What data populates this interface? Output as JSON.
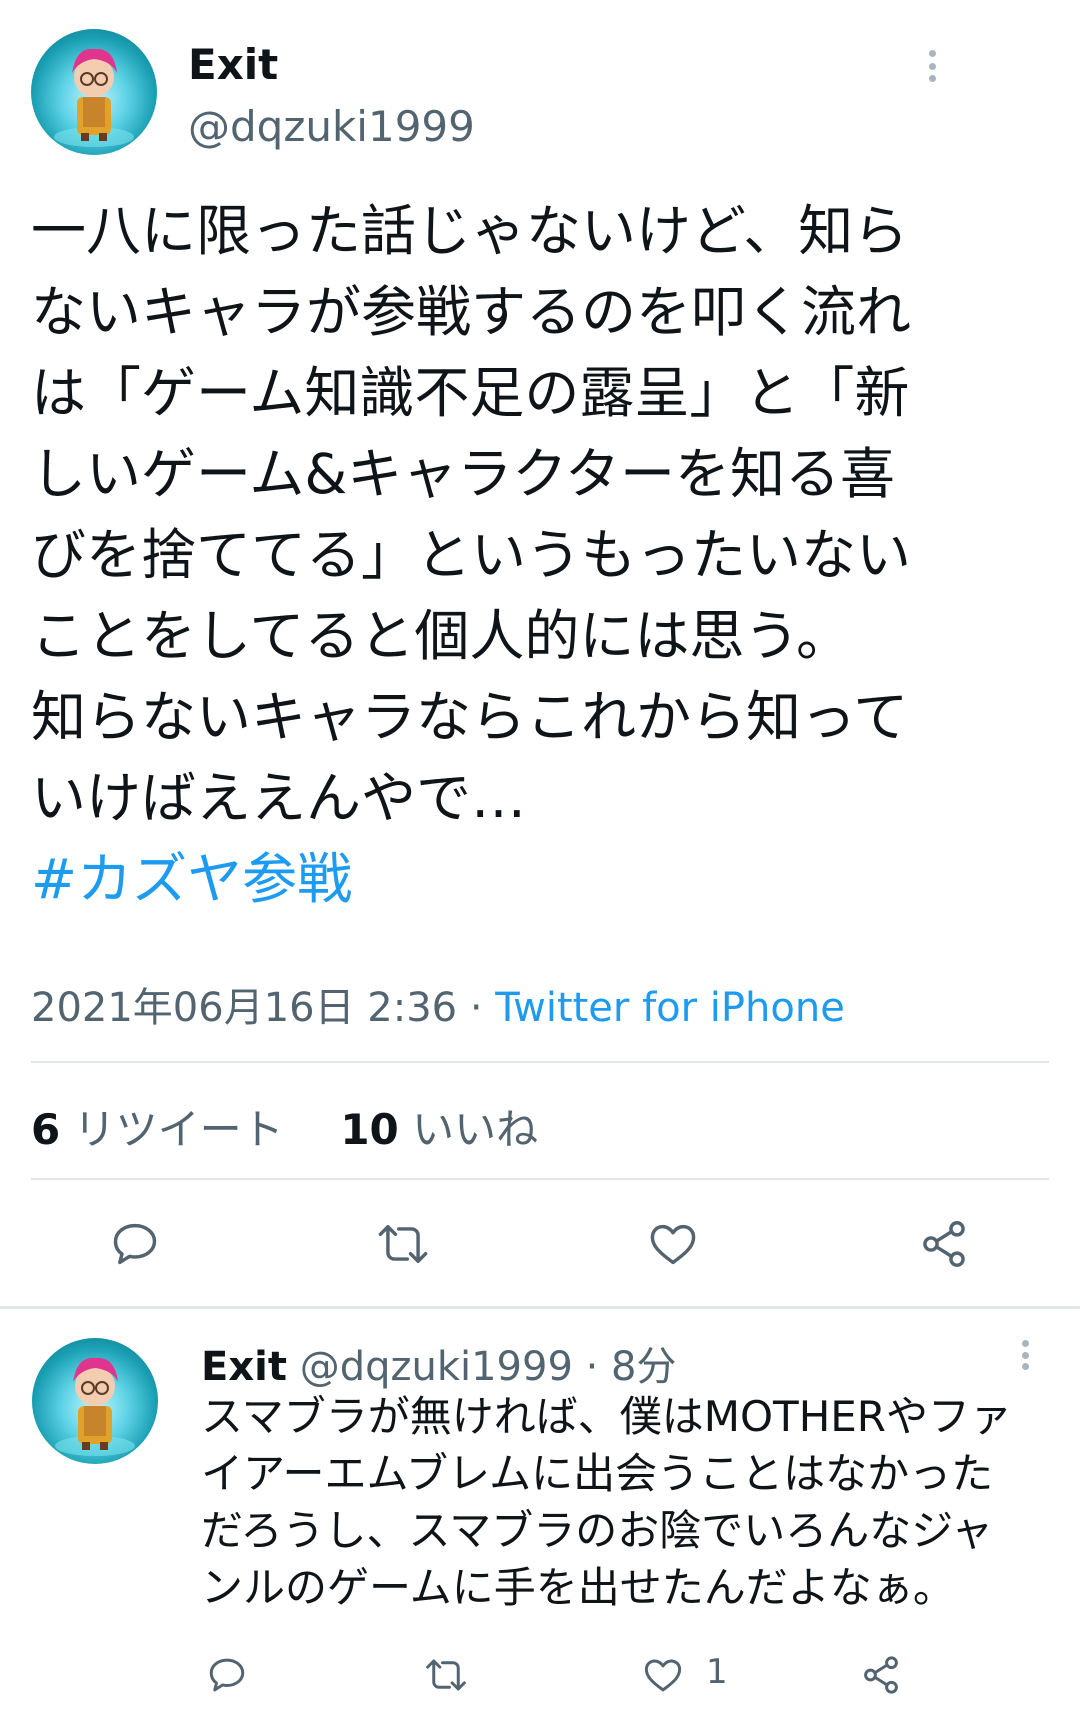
{
  "main_tweet": {
    "author": {
      "name": "Exit",
      "handle": "@dqzuki1999",
      "avatar_icon": "character-avatar"
    },
    "lines": [
      "一八に限った話じゃないけど、知ら",
      "ないキャラが参戦するのを叩く流れ",
      "は「ゲーム知識不足の露呈」と「新",
      "しいゲーム&キャラクターを知る喜",
      "びを捨ててる」というもったいない",
      "ことをしてると個人的には思う。",
      "知らないキャラならこれから知って",
      "いけばええんやで…"
    ],
    "hashtag": "#カズヤ参戦",
    "timestamp": "2021年06月16日 2:36",
    "separator": " · ",
    "source": "Twitter for iPhone",
    "retweet_count": "6",
    "retweet_label": "リツイート",
    "like_count": "10",
    "like_label": "いいね"
  },
  "reply": {
    "author": {
      "name": "Exit",
      "handle": "@dqzuki1999",
      "time": "· 8分",
      "avatar_icon": "character-avatar"
    },
    "lines": [
      "スマブラが無ければ、僕はMOTHERやファ",
      "イアーエムブレムに出会うことはなかった",
      "だろうし、スマブラのお陰でいろんなジャ",
      "ンルのゲームに手を出せたんだよなぁ。"
    ],
    "like_count": "1"
  },
  "colors": {
    "accent": "#1d9bf0",
    "text": "#0f1419",
    "secondary": "#536471",
    "divider": "#e1e6ea"
  }
}
